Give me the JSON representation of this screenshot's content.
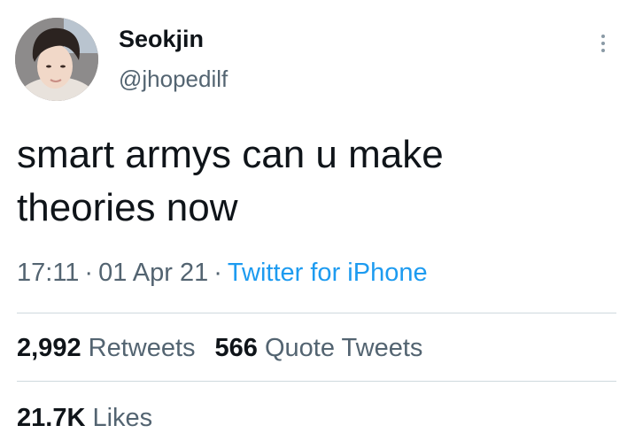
{
  "author": {
    "display_name": "Seokjin",
    "handle": "@jhopedilf",
    "avatar_icon": "profile-photo"
  },
  "tweet": {
    "text_line1": "smart armys can u make",
    "text_line2": "theories now"
  },
  "meta": {
    "time": "17:11",
    "separator": "·",
    "date": "01 Apr 21",
    "source": "Twitter for iPhone"
  },
  "stats": {
    "retweets_count": "2,992",
    "retweets_label": "Retweets",
    "quotes_count": "566",
    "quotes_label": "Quote Tweets",
    "likes_count": "21.7K",
    "likes_label": "Likes"
  },
  "colors": {
    "text": "#0f1419",
    "secondary": "#536471",
    "link": "#1d9bf0",
    "divider": "#cfd9de"
  }
}
